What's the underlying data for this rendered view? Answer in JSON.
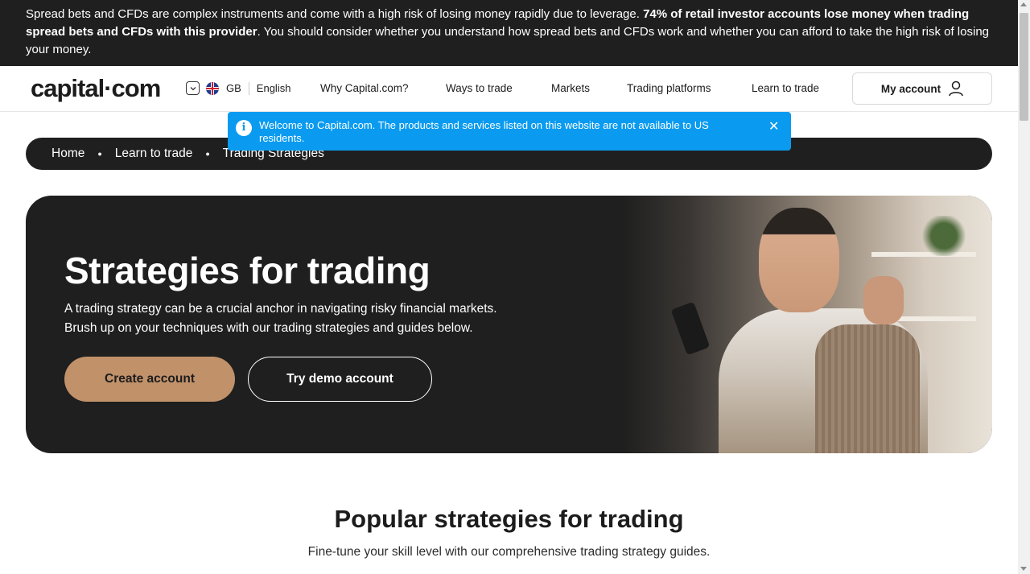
{
  "risk_banner": {
    "text_a": "Spread bets and CFDs are complex instruments and come with a high risk of losing money rapidly due to leverage. ",
    "text_bold": "74% of retail investor accounts lose money when trading spread bets and CFDs with this provider",
    "text_b": ". You should consider whether you understand how spread bets and CFDs work and whether you can afford to take the high risk of losing your money."
  },
  "header": {
    "logo": "capital·com",
    "region_code": "GB",
    "language": "English",
    "nav": [
      "Why Capital.com?",
      "Ways to trade",
      "Markets",
      "Trading platforms",
      "Learn to trade"
    ],
    "account_label": "My account"
  },
  "notice": {
    "text": "Welcome to Capital.com. The products and services listed on this website are not available to US residents.",
    "info_icon": "info-icon",
    "close_icon": "close-icon"
  },
  "breadcrumb": [
    "Home",
    "Learn to trade",
    "Trading Strategies"
  ],
  "hero": {
    "title": "Strategies for trading",
    "text_line1": "A trading strategy can be a crucial anchor in navigating risky financial markets.",
    "text_line2": "Brush up on your techniques with our trading strategies and guides below.",
    "create_label": "Create account",
    "demo_label": "Try demo account"
  },
  "section": {
    "title": "Popular strategies for trading",
    "subtitle": "Fine-tune your skill level with our comprehensive trading strategy guides."
  },
  "colors": {
    "dark": "#1f1f1f",
    "accent": "#c1916a",
    "notice_blue": "#0a9bf0"
  }
}
